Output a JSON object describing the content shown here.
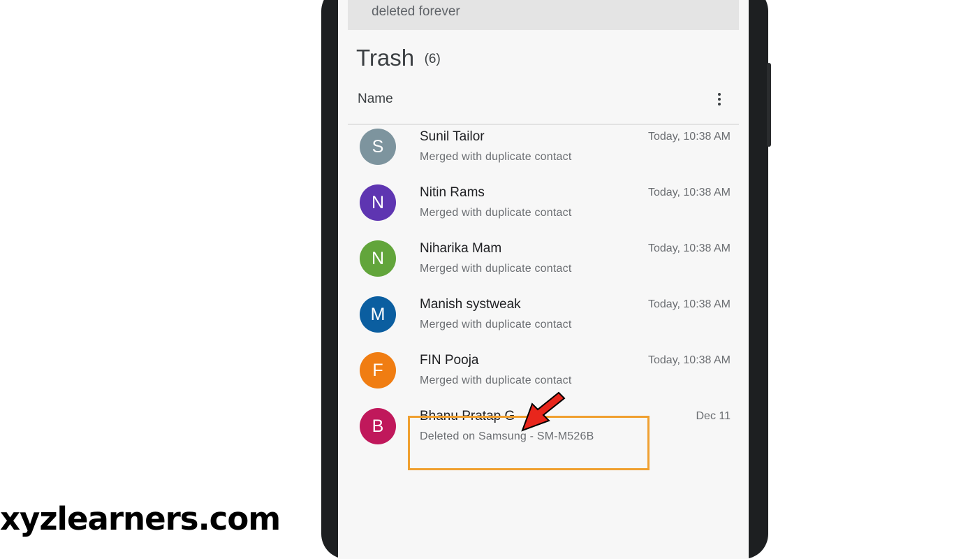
{
  "banner": {
    "text": "deleted forever"
  },
  "header": {
    "title": "Trash",
    "count": "(6)"
  },
  "sort": {
    "label": "Name"
  },
  "contacts": [
    {
      "initial": "S",
      "name": "Sunil Tailor",
      "detail": "Merged with duplicate contact",
      "time": "Today, 10:38 AM",
      "color": "#7d949e"
    },
    {
      "initial": "N",
      "name": "Nitin Rams",
      "detail": "Merged with duplicate contact",
      "time": "Today, 10:38 AM",
      "color": "#5e35b1"
    },
    {
      "initial": "N",
      "name": "Niharika Mam",
      "detail": "Merged with duplicate contact",
      "time": "Today, 10:38 AM",
      "color": "#62a53b"
    },
    {
      "initial": "M",
      "name": "Manish systweak",
      "detail": "Merged with duplicate contact",
      "time": "Today, 10:38 AM",
      "color": "#0b5ea0"
    },
    {
      "initial": "F",
      "name": "FIN Pooja",
      "detail": "Merged with duplicate contact",
      "time": "Today, 10:38 AM",
      "color": "#f07d12"
    },
    {
      "initial": "B",
      "name": "Bhanu Pratap G",
      "detail": "Deleted on Samsung - SM-M526B",
      "time": "Dec 11",
      "color": "#c0185b"
    }
  ],
  "annotation": {
    "highlight_color": "#f0a030",
    "arrow_color": "#e8261c"
  },
  "watermark": {
    "text": "xyzlearners.com"
  }
}
